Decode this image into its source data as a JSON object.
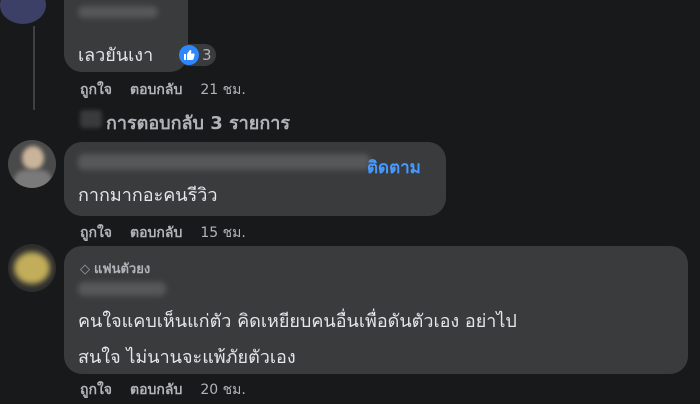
{
  "comments": [
    {
      "text": "เลวยันเงา",
      "reaction_count": "3",
      "like": "ถูกใจ",
      "reply": "ตอบกลับ",
      "time": "21 ชม."
    },
    {
      "follow_label": "ติดตาม",
      "text": "กากมากอะคนรีวิว",
      "like": "ถูกใจ",
      "reply": "ตอบกลับ",
      "time": "15 ชม."
    },
    {
      "badge": "แฟนตัวยง",
      "text_line1": "คนใจแคบเห็นแก่ตัว คิดเหยียบคนอื่นเพื่อดันตัวเอง อย่าไป",
      "text_line2": "สนใจ ไม่นานจะแพ้ภัยตัวเอง",
      "like": "ถูกใจ",
      "reply": "ตอบกลับ",
      "time": "20 ชม."
    }
  ],
  "replies_link": "การตอบกลับ 3 รายการ",
  "colors": {
    "background": "#18191a",
    "bubble": "#3a3b3c",
    "accent": "#4599ff",
    "like_blue": "#2d88ff"
  },
  "icons": [
    "like-reaction-icon",
    "reply-arrow-icon",
    "diamond-icon"
  ]
}
